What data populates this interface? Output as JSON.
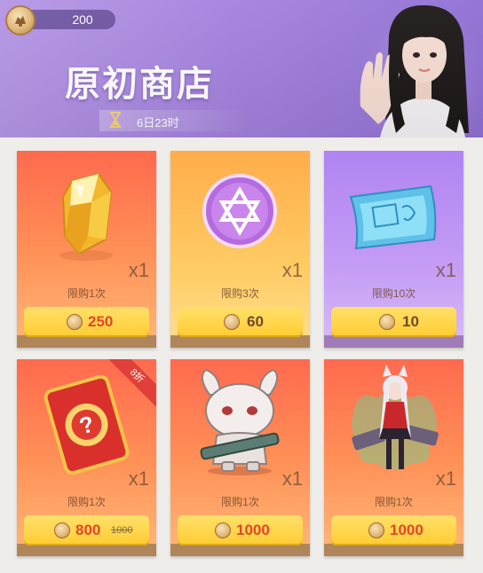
{
  "header": {
    "currency_amount": "200",
    "title": "原初商店",
    "timer": "6日23时"
  },
  "colors": {
    "header": "#a17fdc",
    "price_red": "#e5452b",
    "button": "#ffcc31"
  },
  "items": [
    {
      "icon": "yellow-crystal-icon",
      "qty": "x1",
      "limit": "限购1次",
      "price": "250",
      "old_price": ""
    },
    {
      "icon": "purple-star-coin-icon",
      "qty": "x1",
      "limit": "限购3次",
      "price": "60",
      "old_price": ""
    },
    {
      "icon": "blue-ticket-icon",
      "qty": "x1",
      "limit": "限购10次",
      "price": "10",
      "old_price": ""
    },
    {
      "icon": "mystery-card-icon",
      "qty": "x1",
      "limit": "限购1次",
      "price": "800",
      "old_price": "1000",
      "badge": "8折"
    },
    {
      "icon": "bunny-character-icon",
      "qty": "x1",
      "limit": "限购1次",
      "price": "1000",
      "old_price": ""
    },
    {
      "icon": "catgirl-character-icon",
      "qty": "x1",
      "limit": "限购1次",
      "price": "1000",
      "old_price": ""
    }
  ]
}
